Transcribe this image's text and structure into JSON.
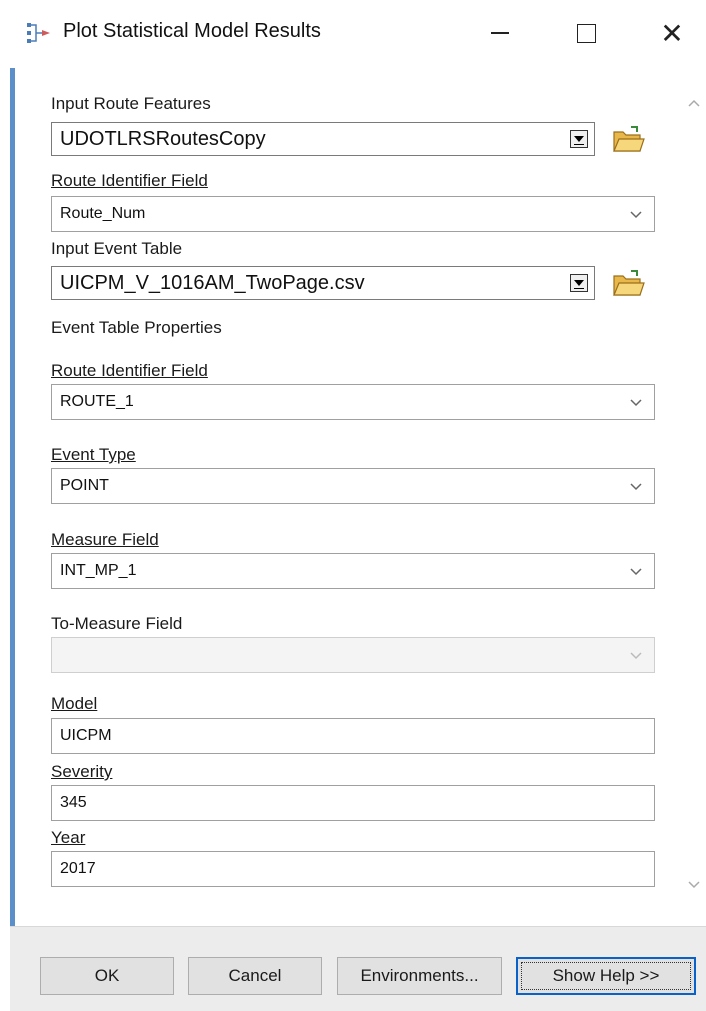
{
  "window": {
    "title": "Plot Statistical Model Results",
    "icon": "tool-icon"
  },
  "form": {
    "input_route_features": {
      "label": "Input Route Features",
      "value": "UDOTLRSRoutesCopy"
    },
    "route_identifier_field": {
      "label": "Route Identifier Field",
      "value": "Route_Num"
    },
    "input_event_table": {
      "label": "Input Event Table",
      "value": "UICPM_V_1016AM_TwoPage.csv"
    },
    "event_table_properties": {
      "label": "Event Table Properties"
    },
    "event_route_identifier_field": {
      "label": "Route Identifier Field",
      "value": "ROUTE_1"
    },
    "event_type": {
      "label": "Event Type",
      "value": "POINT"
    },
    "measure_field": {
      "label": "Measure Field",
      "value": "INT_MP_1"
    },
    "to_measure_field": {
      "label": "To-Measure Field",
      "value": ""
    },
    "model": {
      "label": "Model",
      "value": "UICPM"
    },
    "severity": {
      "label": "Severity",
      "value": "345"
    },
    "year": {
      "label": "Year",
      "value": "2017"
    }
  },
  "buttons": {
    "ok": "OK",
    "cancel": "Cancel",
    "environments": "Environments...",
    "show_help": "Show Help >>"
  },
  "colors": {
    "accent": "#5b8fc9",
    "focus": "#0a62c9",
    "folder": "#e8b84a"
  }
}
